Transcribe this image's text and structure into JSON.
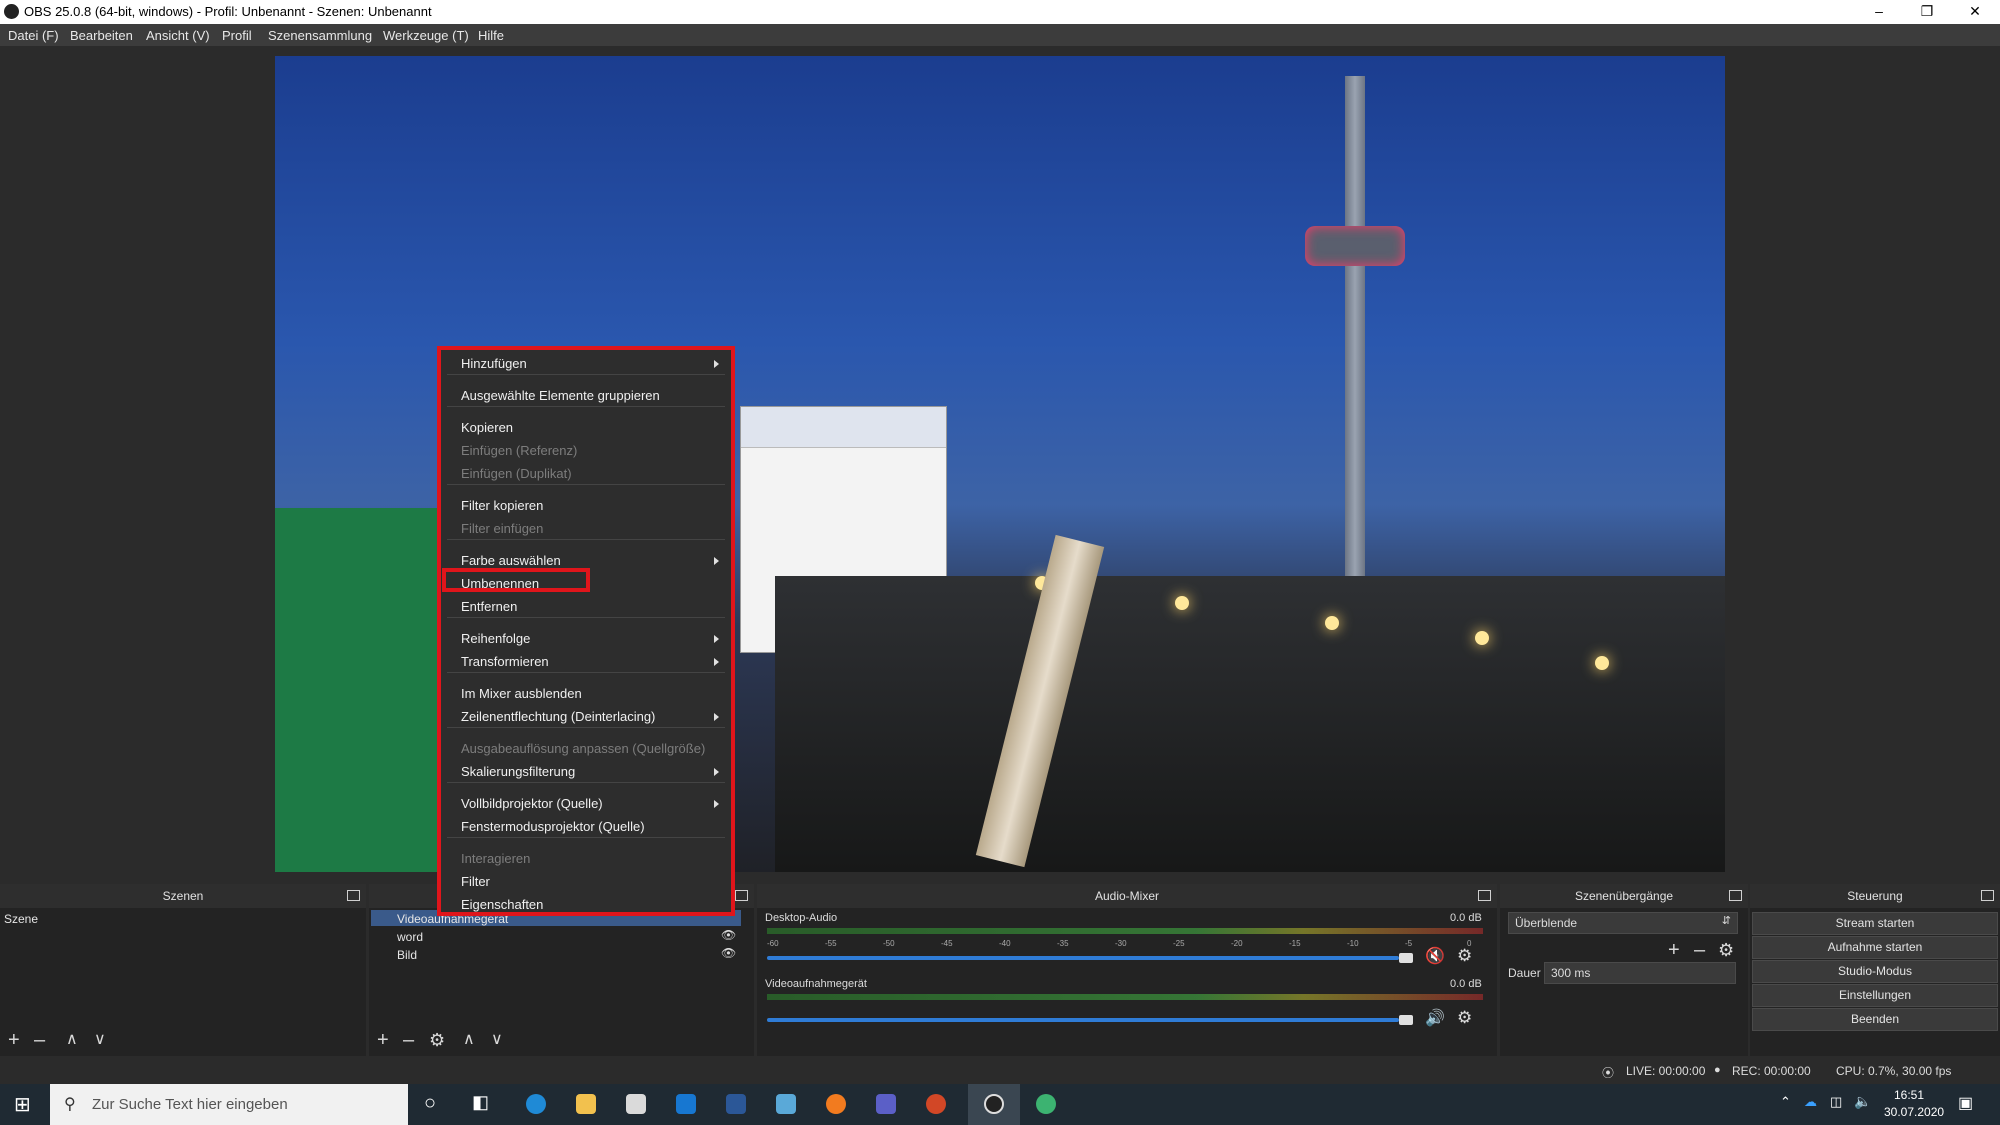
{
  "window": {
    "title": "OBS 25.0.8 (64-bit, windows) - Profil: Unbenannt - Szenen: Unbenannt"
  },
  "menubar": [
    "Datei (F)",
    "Bearbeiten",
    "Ansicht (V)",
    "Profil",
    "Szenensammlung",
    "Werkzeuge (T)",
    "Hilfe"
  ],
  "context_menu": {
    "items": [
      {
        "label": "Hinzufügen",
        "disabled": false,
        "submenu": true
      },
      {
        "label": "Ausgewählte Elemente gruppieren",
        "disabled": false,
        "submenu": false
      },
      {
        "label": "Kopieren",
        "disabled": false,
        "submenu": false
      },
      {
        "label": "Einfügen (Referenz)",
        "disabled": true,
        "submenu": false
      },
      {
        "label": "Einfügen (Duplikat)",
        "disabled": true,
        "submenu": false
      },
      {
        "label": "Filter kopieren",
        "disabled": false,
        "submenu": false
      },
      {
        "label": "Filter einfügen",
        "disabled": true,
        "submenu": false
      },
      {
        "label": "Farbe auswählen",
        "disabled": false,
        "submenu": true
      },
      {
        "label": "Umbenennen",
        "disabled": false,
        "submenu": false
      },
      {
        "label": "Entfernen",
        "disabled": false,
        "submenu": false
      },
      {
        "label": "Reihenfolge",
        "disabled": false,
        "submenu": true
      },
      {
        "label": "Transformieren",
        "disabled": false,
        "submenu": true
      },
      {
        "label": "Im Mixer ausblenden",
        "disabled": false,
        "submenu": false
      },
      {
        "label": "Zeilenentflechtung (Deinterlacing)",
        "disabled": false,
        "submenu": true
      },
      {
        "label": "Ausgabeauflösung anpassen (Quellgröße)",
        "disabled": true,
        "submenu": false
      },
      {
        "label": "Skalierungsfilterung",
        "disabled": false,
        "submenu": true
      },
      {
        "label": "Vollbildprojektor (Quelle)",
        "disabled": false,
        "submenu": true
      },
      {
        "label": "Fenstermodusprojektor (Quelle)",
        "disabled": false,
        "submenu": false
      },
      {
        "label": "Interagieren",
        "disabled": true,
        "submenu": false
      },
      {
        "label": "Filter",
        "disabled": false,
        "submenu": false
      },
      {
        "label": "Eigenschaften",
        "disabled": false,
        "submenu": false
      }
    ]
  },
  "scenes": {
    "header": "Szenen",
    "items": [
      "Szene"
    ]
  },
  "sources": {
    "items": [
      "Videoaufnahmegerät",
      "word",
      "Bild"
    ]
  },
  "mixer": {
    "header": "Audio-Mixer",
    "channels": [
      {
        "name": "Desktop-Audio",
        "db": "0.0 dB",
        "muted": true
      },
      {
        "name": "Videoaufnahmegerät",
        "db": "0.0 dB",
        "muted": false
      }
    ],
    "scale": [
      "-60",
      "-55",
      "-50",
      "-45",
      "-40",
      "-35",
      "-30",
      "-25",
      "-20",
      "-15",
      "-10",
      "-5",
      "0"
    ]
  },
  "transitions": {
    "header": "Szenenübergänge",
    "selected": "Überblende",
    "duration_label": "Dauer",
    "duration_value": "300 ms"
  },
  "controls": {
    "header": "Steuerung",
    "buttons": [
      "Stream starten",
      "Aufnahme starten",
      "Studio-Modus",
      "Einstellungen",
      "Beenden"
    ]
  },
  "status": {
    "live": "LIVE: 00:00:00",
    "rec": "REC: 00:00:00",
    "cpu": "CPU: 0.7%, 30.00 fps"
  },
  "taskbar": {
    "search_placeholder": "Zur Suche Text hier eingeben",
    "time": "16:51",
    "date": "30.07.2020"
  },
  "colors": {
    "highlight_border": "#e0151b",
    "accent": "#2f7cd6"
  }
}
